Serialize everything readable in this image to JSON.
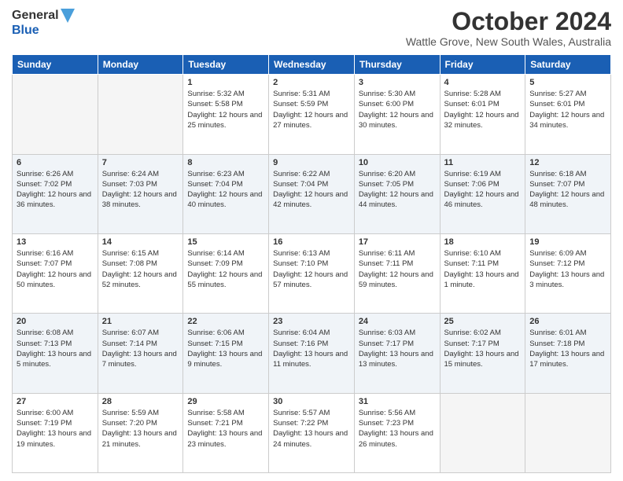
{
  "logo": {
    "line1": "General",
    "line2": "Blue"
  },
  "title": "October 2024",
  "subtitle": "Wattle Grove, New South Wales, Australia",
  "days_of_week": [
    "Sunday",
    "Monday",
    "Tuesday",
    "Wednesday",
    "Thursday",
    "Friday",
    "Saturday"
  ],
  "weeks": [
    {
      "shaded": false,
      "days": [
        {
          "num": "",
          "info": ""
        },
        {
          "num": "",
          "info": ""
        },
        {
          "num": "1",
          "info": "Sunrise: 5:32 AM\nSunset: 5:58 PM\nDaylight: 12 hours\nand 25 minutes."
        },
        {
          "num": "2",
          "info": "Sunrise: 5:31 AM\nSunset: 5:59 PM\nDaylight: 12 hours\nand 27 minutes."
        },
        {
          "num": "3",
          "info": "Sunrise: 5:30 AM\nSunset: 6:00 PM\nDaylight: 12 hours\nand 30 minutes."
        },
        {
          "num": "4",
          "info": "Sunrise: 5:28 AM\nSunset: 6:01 PM\nDaylight: 12 hours\nand 32 minutes."
        },
        {
          "num": "5",
          "info": "Sunrise: 5:27 AM\nSunset: 6:01 PM\nDaylight: 12 hours\nand 34 minutes."
        }
      ]
    },
    {
      "shaded": true,
      "days": [
        {
          "num": "6",
          "info": "Sunrise: 6:26 AM\nSunset: 7:02 PM\nDaylight: 12 hours\nand 36 minutes."
        },
        {
          "num": "7",
          "info": "Sunrise: 6:24 AM\nSunset: 7:03 PM\nDaylight: 12 hours\nand 38 minutes."
        },
        {
          "num": "8",
          "info": "Sunrise: 6:23 AM\nSunset: 7:04 PM\nDaylight: 12 hours\nand 40 minutes."
        },
        {
          "num": "9",
          "info": "Sunrise: 6:22 AM\nSunset: 7:04 PM\nDaylight: 12 hours\nand 42 minutes."
        },
        {
          "num": "10",
          "info": "Sunrise: 6:20 AM\nSunset: 7:05 PM\nDaylight: 12 hours\nand 44 minutes."
        },
        {
          "num": "11",
          "info": "Sunrise: 6:19 AM\nSunset: 7:06 PM\nDaylight: 12 hours\nand 46 minutes."
        },
        {
          "num": "12",
          "info": "Sunrise: 6:18 AM\nSunset: 7:07 PM\nDaylight: 12 hours\nand 48 minutes."
        }
      ]
    },
    {
      "shaded": false,
      "days": [
        {
          "num": "13",
          "info": "Sunrise: 6:16 AM\nSunset: 7:07 PM\nDaylight: 12 hours\nand 50 minutes."
        },
        {
          "num": "14",
          "info": "Sunrise: 6:15 AM\nSunset: 7:08 PM\nDaylight: 12 hours\nand 52 minutes."
        },
        {
          "num": "15",
          "info": "Sunrise: 6:14 AM\nSunset: 7:09 PM\nDaylight: 12 hours\nand 55 minutes."
        },
        {
          "num": "16",
          "info": "Sunrise: 6:13 AM\nSunset: 7:10 PM\nDaylight: 12 hours\nand 57 minutes."
        },
        {
          "num": "17",
          "info": "Sunrise: 6:11 AM\nSunset: 7:11 PM\nDaylight: 12 hours\nand 59 minutes."
        },
        {
          "num": "18",
          "info": "Sunrise: 6:10 AM\nSunset: 7:11 PM\nDaylight: 13 hours\nand 1 minute."
        },
        {
          "num": "19",
          "info": "Sunrise: 6:09 AM\nSunset: 7:12 PM\nDaylight: 13 hours\nand 3 minutes."
        }
      ]
    },
    {
      "shaded": true,
      "days": [
        {
          "num": "20",
          "info": "Sunrise: 6:08 AM\nSunset: 7:13 PM\nDaylight: 13 hours\nand 5 minutes."
        },
        {
          "num": "21",
          "info": "Sunrise: 6:07 AM\nSunset: 7:14 PM\nDaylight: 13 hours\nand 7 minutes."
        },
        {
          "num": "22",
          "info": "Sunrise: 6:06 AM\nSunset: 7:15 PM\nDaylight: 13 hours\nand 9 minutes."
        },
        {
          "num": "23",
          "info": "Sunrise: 6:04 AM\nSunset: 7:16 PM\nDaylight: 13 hours\nand 11 minutes."
        },
        {
          "num": "24",
          "info": "Sunrise: 6:03 AM\nSunset: 7:17 PM\nDaylight: 13 hours\nand 13 minutes."
        },
        {
          "num": "25",
          "info": "Sunrise: 6:02 AM\nSunset: 7:17 PM\nDaylight: 13 hours\nand 15 minutes."
        },
        {
          "num": "26",
          "info": "Sunrise: 6:01 AM\nSunset: 7:18 PM\nDaylight: 13 hours\nand 17 minutes."
        }
      ]
    },
    {
      "shaded": false,
      "days": [
        {
          "num": "27",
          "info": "Sunrise: 6:00 AM\nSunset: 7:19 PM\nDaylight: 13 hours\nand 19 minutes."
        },
        {
          "num": "28",
          "info": "Sunrise: 5:59 AM\nSunset: 7:20 PM\nDaylight: 13 hours\nand 21 minutes."
        },
        {
          "num": "29",
          "info": "Sunrise: 5:58 AM\nSunset: 7:21 PM\nDaylight: 13 hours\nand 23 minutes."
        },
        {
          "num": "30",
          "info": "Sunrise: 5:57 AM\nSunset: 7:22 PM\nDaylight: 13 hours\nand 24 minutes."
        },
        {
          "num": "31",
          "info": "Sunrise: 5:56 AM\nSunset: 7:23 PM\nDaylight: 13 hours\nand 26 minutes."
        },
        {
          "num": "",
          "info": ""
        },
        {
          "num": "",
          "info": ""
        }
      ]
    }
  ]
}
